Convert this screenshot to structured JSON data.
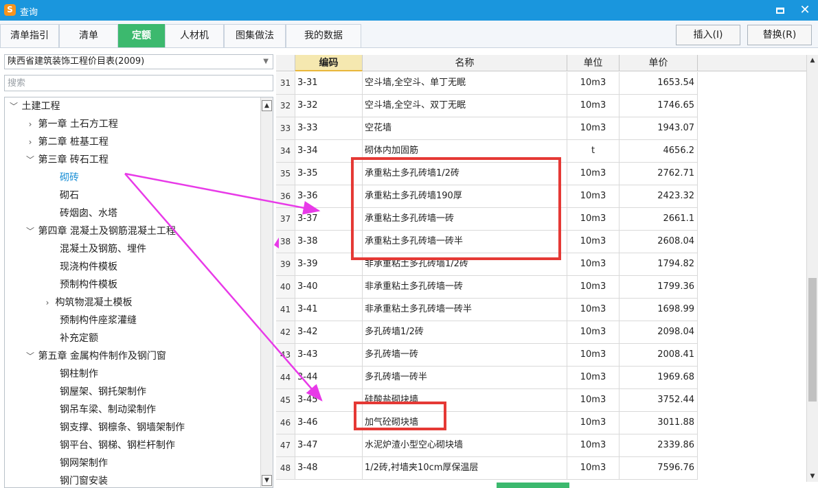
{
  "window": {
    "title": "查询",
    "logo_char": "S",
    "maximize_icon": "maximize-icon",
    "close_icon": "close-icon",
    "close_glyph": "✕"
  },
  "tabs": [
    {
      "label": "清单指引",
      "active": false
    },
    {
      "label": "清单",
      "active": false
    },
    {
      "label": "定额",
      "active": true
    },
    {
      "label": "人材机",
      "active": false
    },
    {
      "label": "图集做法",
      "active": false
    },
    {
      "label": "我的数据",
      "active": false
    }
  ],
  "toolbar": {
    "insert_label": "插入(I)",
    "replace_label": "替换(R)"
  },
  "library": {
    "selected": "陕西省建筑装饰工程价目表(2009)",
    "caret_icon": "dropdown-caret-icon"
  },
  "search": {
    "placeholder": "搜索",
    "value": ""
  },
  "tree": [
    {
      "label": "土建工程",
      "toggle": "expanded"
    },
    {
      "label": "第一章 土石方工程",
      "toggle": "collapsed"
    },
    {
      "label": "第二章 桩基工程",
      "toggle": "collapsed"
    },
    {
      "label": "第三章 砖石工程",
      "toggle": "expanded"
    },
    {
      "label": "砌砖",
      "toggle": "none",
      "selected": true
    },
    {
      "label": "砌石",
      "toggle": "none"
    },
    {
      "label": "砖烟囱、水塔",
      "toggle": "none"
    },
    {
      "label": "第四章 混凝土及钢筋混凝土工程",
      "toggle": "expanded"
    },
    {
      "label": "混凝土及钢筋、埋件",
      "toggle": "none"
    },
    {
      "label": "现浇构件模板",
      "toggle": "none"
    },
    {
      "label": "预制构件模板",
      "toggle": "none"
    },
    {
      "label": "构筑物混凝土模板",
      "toggle": "collapsed"
    },
    {
      "label": "预制构件座浆灌缝",
      "toggle": "none"
    },
    {
      "label": "补充定额",
      "toggle": "none"
    },
    {
      "label": "第五章 金属构件制作及钢门窗",
      "toggle": "expanded"
    },
    {
      "label": "钢柱制作",
      "toggle": "none"
    },
    {
      "label": "钢屋架、钢托架制作",
      "toggle": "none"
    },
    {
      "label": "钢吊车梁、制动梁制作",
      "toggle": "none"
    },
    {
      "label": "钢支撑、钢檩条、钢墙架制作",
      "toggle": "none"
    },
    {
      "label": "钢平台、钢梯、钢栏杆制作",
      "toggle": "none"
    },
    {
      "label": "钢网架制作",
      "toggle": "none"
    },
    {
      "label": "钢门窗安装",
      "toggle": "none"
    }
  ],
  "grid": {
    "headers": {
      "code": "编码",
      "name": "名称",
      "unit": "单位",
      "price": "单价"
    },
    "rows": [
      {
        "idx": "31",
        "code": "3-31",
        "name": "空斗墙,全空斗、单丁无眠",
        "unit": "10m3",
        "price": "1653.54"
      },
      {
        "idx": "32",
        "code": "3-32",
        "name": "空斗墙,全空斗、双丁无眠",
        "unit": "10m3",
        "price": "1746.65"
      },
      {
        "idx": "33",
        "code": "3-33",
        "name": "空花墙",
        "unit": "10m3",
        "price": "1943.07"
      },
      {
        "idx": "34",
        "code": "3-34",
        "name": "砌体内加固筋",
        "unit": "t",
        "price": "4656.2"
      },
      {
        "idx": "35",
        "code": "3-35",
        "name": "承重粘土多孔砖墙1/2砖",
        "unit": "10m3",
        "price": "2762.71"
      },
      {
        "idx": "36",
        "code": "3-36",
        "name": "承重粘土多孔砖墙190厚",
        "unit": "10m3",
        "price": "2423.32"
      },
      {
        "idx": "37",
        "code": "3-37",
        "name": "承重粘土多孔砖墙一砖",
        "unit": "10m3",
        "price": "2661.1"
      },
      {
        "idx": "38",
        "code": "3-38",
        "name": "承重粘土多孔砖墙一砖半",
        "unit": "10m3",
        "price": "2608.04"
      },
      {
        "idx": "39",
        "code": "3-39",
        "name": "非承重粘土多孔砖墙1/2砖",
        "unit": "10m3",
        "price": "1794.82"
      },
      {
        "idx": "40",
        "code": "3-40",
        "name": "非承重粘土多孔砖墙一砖",
        "unit": "10m3",
        "price": "1799.36"
      },
      {
        "idx": "41",
        "code": "3-41",
        "name": "非承重粘土多孔砖墙一砖半",
        "unit": "10m3",
        "price": "1698.99"
      },
      {
        "idx": "42",
        "code": "3-42",
        "name": "多孔砖墙1/2砖",
        "unit": "10m3",
        "price": "2098.04"
      },
      {
        "idx": "43",
        "code": "3-43",
        "name": "多孔砖墙一砖",
        "unit": "10m3",
        "price": "2008.41"
      },
      {
        "idx": "44",
        "code": "3-44",
        "name": "多孔砖墙一砖半",
        "unit": "10m3",
        "price": "1969.68"
      },
      {
        "idx": "45",
        "code": "3-45",
        "name": "硅酸盐砌块墙",
        "unit": "10m3",
        "price": "3752.44"
      },
      {
        "idx": "46",
        "code": "3-46",
        "name": "加气砼砌块墙",
        "unit": "10m3",
        "price": "3011.88"
      },
      {
        "idx": "47",
        "code": "3-47",
        "name": "水泥炉渣小型空心砌块墙",
        "unit": "10m3",
        "price": "2339.86"
      },
      {
        "idx": "48",
        "code": "3-48",
        "name": "1/2砖,衬墙夹10cm厚保温层",
        "unit": "10m3",
        "price": "7596.76"
      }
    ]
  },
  "annotations": {
    "box_color": "#e53935",
    "arrow_color": "#e83ae8"
  },
  "icons": {
    "expanded": "chevron-down-icon",
    "collapsed": "chevron-right-icon",
    "scroll_up": "scroll-up-arrow-icon",
    "scroll_down": "scroll-down-arrow-icon"
  }
}
